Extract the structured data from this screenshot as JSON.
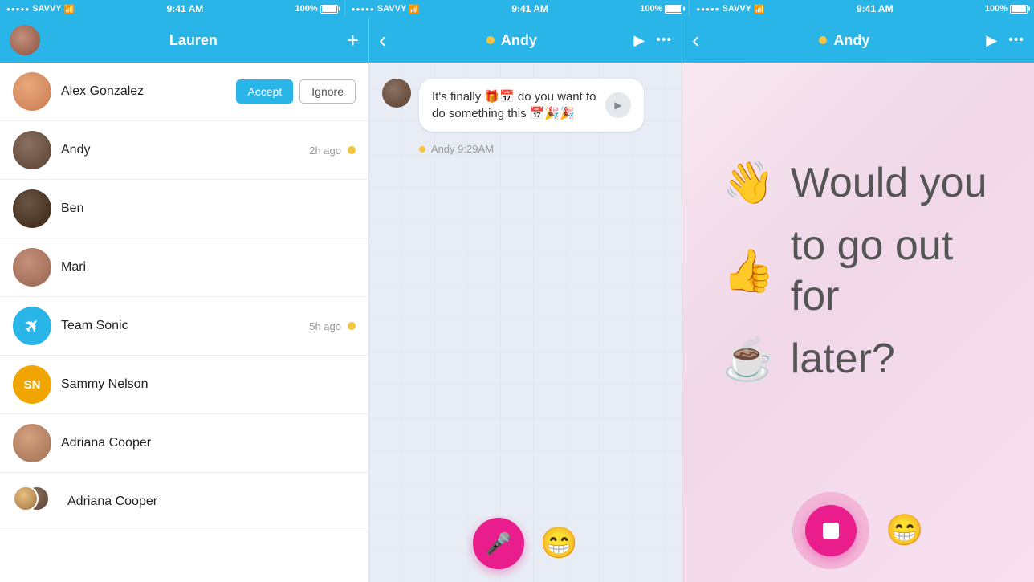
{
  "status_bars": [
    {
      "carrier": "SAVVY",
      "time": "9:41 AM",
      "battery": "100%"
    },
    {
      "carrier": "SAVVY",
      "time": "9:41 AM",
      "battery": "100%"
    },
    {
      "carrier": "SAVVY",
      "time": "9:41 AM",
      "battery": "100%"
    }
  ],
  "panel1": {
    "header": {
      "title": "Lauren",
      "add_icon": "+"
    },
    "contacts": [
      {
        "name": "Alex Gonzalez",
        "avatar_type": "image",
        "avatar_class": "avatar-alex",
        "has_actions": true,
        "accept_label": "Accept",
        "ignore_label": "Ignore"
      },
      {
        "name": "Andy",
        "avatar_type": "image",
        "avatar_class": "avatar-andy",
        "time": "2h ago",
        "online": true
      },
      {
        "name": "Ben",
        "avatar_type": "image",
        "avatar_class": "avatar-ben"
      },
      {
        "name": "Mari",
        "avatar_type": "image",
        "avatar_class": "avatar-mari"
      },
      {
        "name": "Team Sonic",
        "avatar_type": "icon",
        "avatar_class": "avatar-team",
        "avatar_icon": "✈",
        "time": "5h ago",
        "online": true
      },
      {
        "name": "Sammy Nelson",
        "avatar_type": "initials",
        "avatar_class": "avatar-sn",
        "initials": "SN"
      },
      {
        "name": "Adriana Cooper",
        "avatar_type": "image",
        "avatar_class": "avatar-adriana1"
      },
      {
        "name": "Adriana Cooper",
        "avatar_type": "group",
        "avatar_class": "avatar-adriana2"
      }
    ]
  },
  "panel2": {
    "header": {
      "back_icon": "‹",
      "contact_name": "Andy",
      "play_icon": "▶",
      "more_icon": "•••",
      "online": true
    },
    "message": {
      "text": "It's finally 🎁📅 do you want to do something this 📅🎉🎉",
      "sender": "Andy",
      "time": "9:29AM",
      "online": true
    },
    "mic_icon": "🎤",
    "emoji": "😁"
  },
  "panel3": {
    "header": {
      "back_icon": "‹",
      "contact_name": "Andy",
      "play_icon": "▶",
      "more_icon": "•••",
      "online": true
    },
    "voice_lines": [
      {
        "emoji": "👋",
        "text": "Would you"
      },
      {
        "emoji": "👍",
        "text": "to go out for"
      },
      {
        "emoji": "☕",
        "text": "later?"
      }
    ],
    "stop_icon": "■",
    "emoji": "😁"
  }
}
